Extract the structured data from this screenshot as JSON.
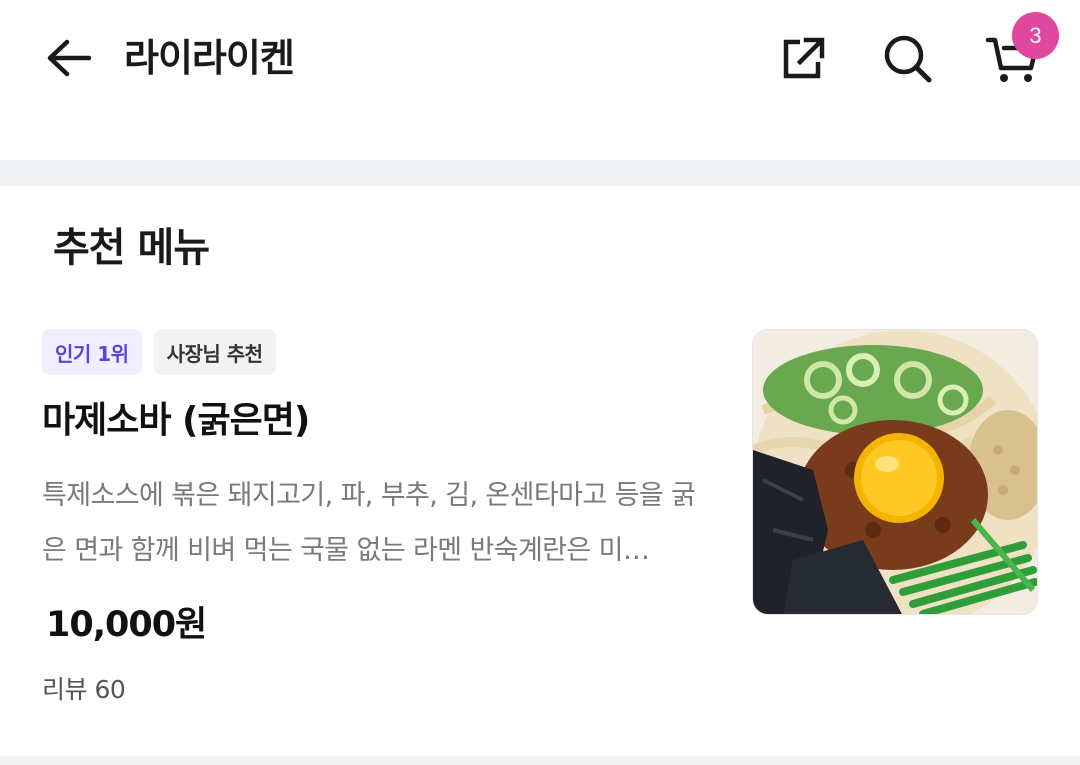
{
  "header": {
    "title": "라이라이켄",
    "back_icon": "arrow-left-icon",
    "share_icon": "share-external-icon",
    "search_icon": "search-icon",
    "cart_icon": "cart-icon",
    "cart_count": "3",
    "badge_color": "#e0479e"
  },
  "section": {
    "title": "추천 메뉴"
  },
  "menu_item": {
    "tags": [
      "인기 1위",
      "사장님 추천"
    ],
    "name": "마제소바 (굵은면)",
    "description": "특제소스에 볶은 돼지고기, 파, 부추, 김, 온센타마고 등을 굵은 면과 함께 비벼 먹는 국물 없는 라멘 반숙계란은  미…",
    "price": "10,000원",
    "reviews": "리뷰 60",
    "photo_icon": "food-photo"
  },
  "colors": {
    "accent_tag_bg": "#f1efff",
    "accent_tag_text": "#5b45d6",
    "divider": "#f1f2f4"
  }
}
